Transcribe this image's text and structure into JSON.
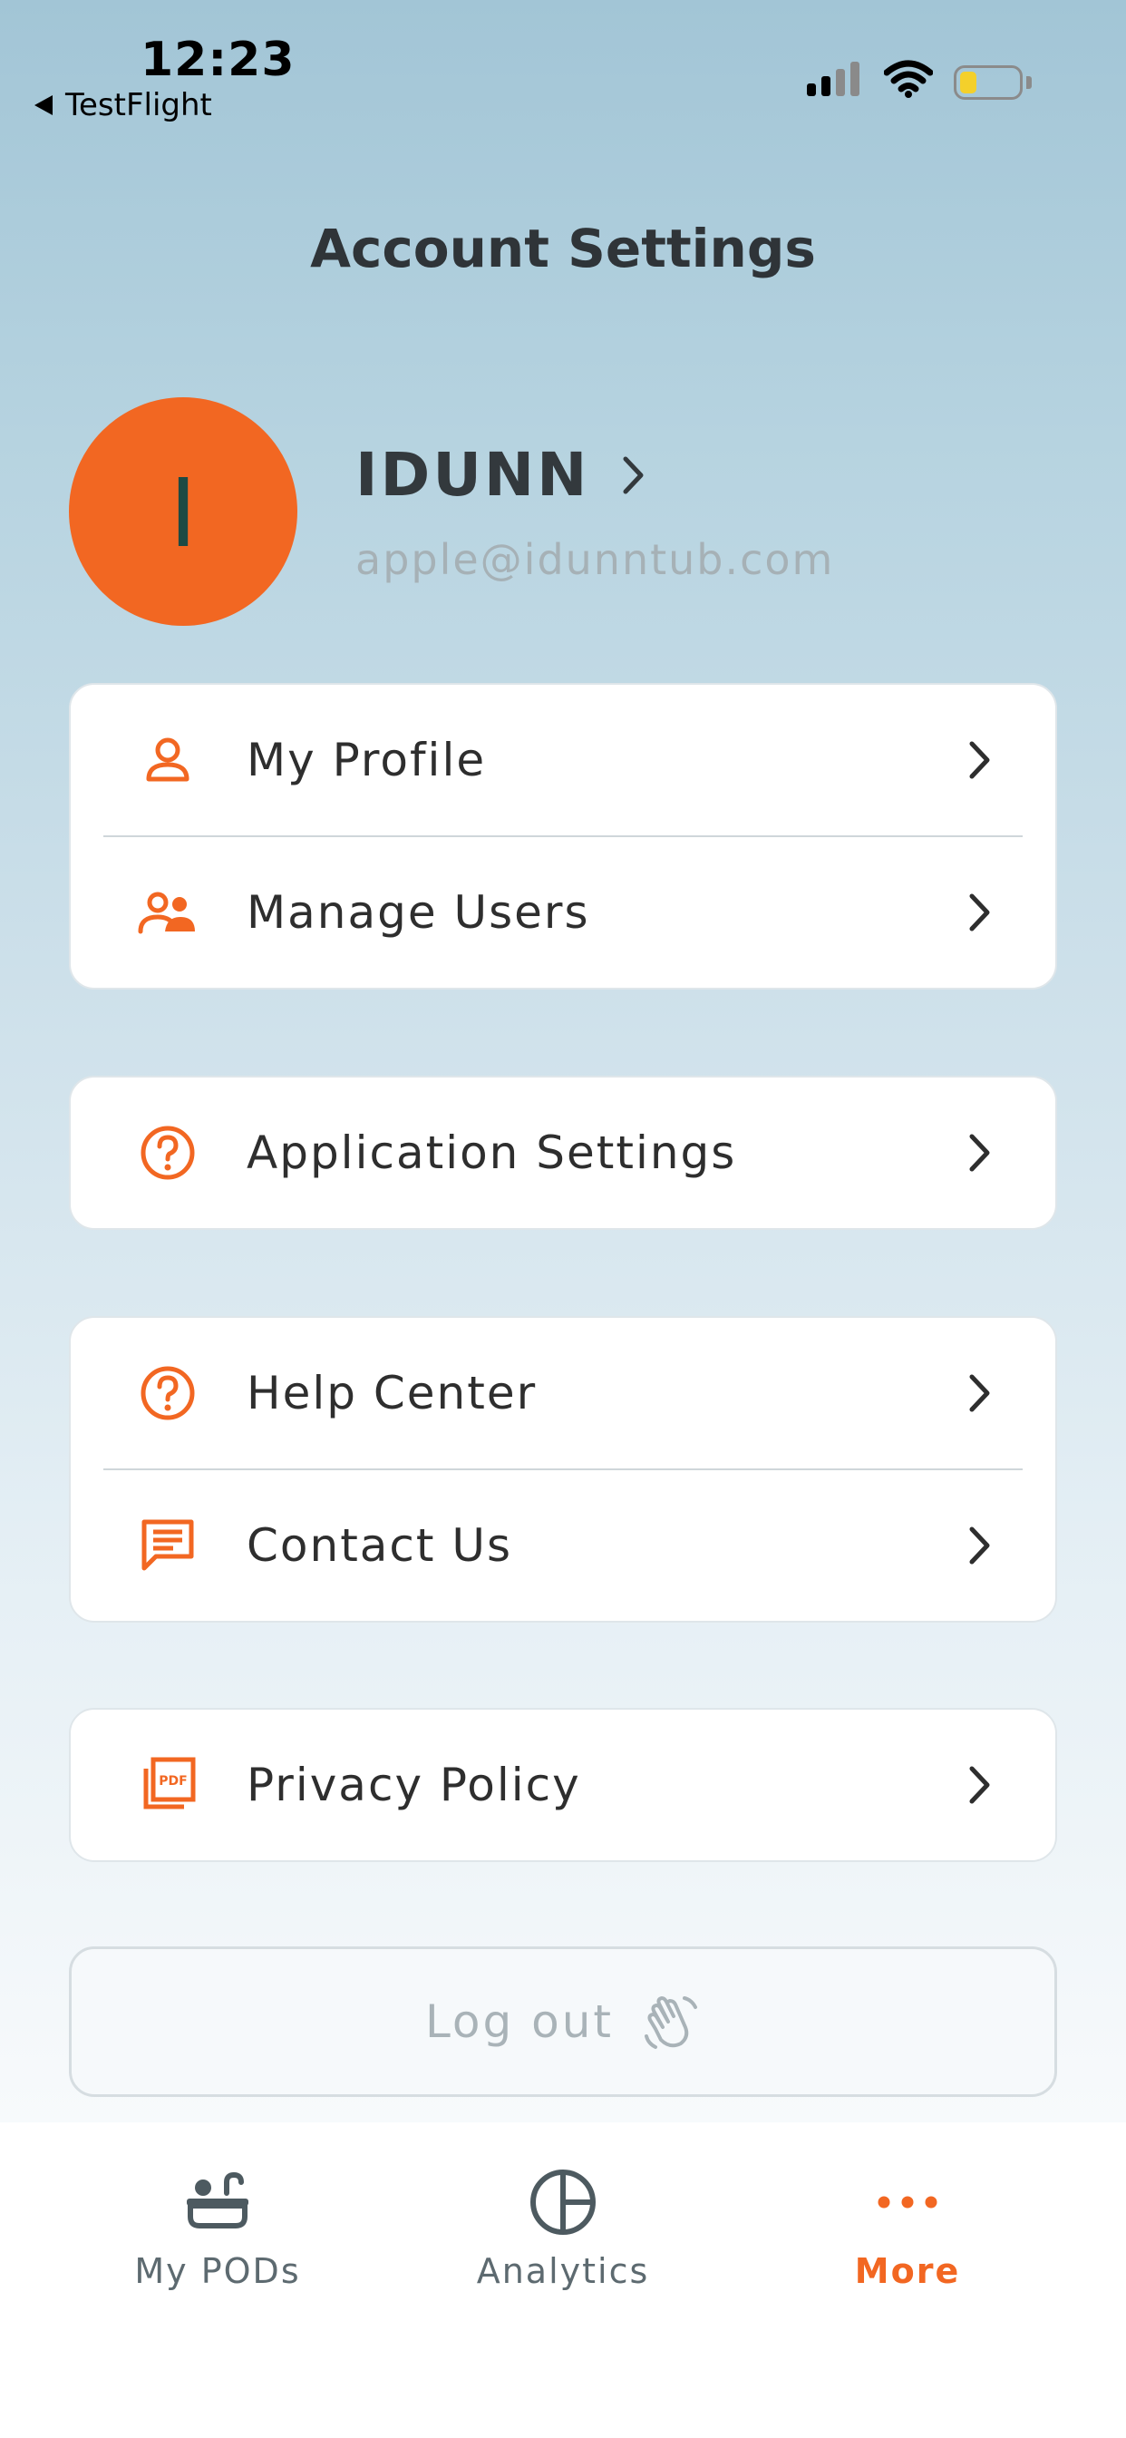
{
  "status_bar": {
    "time": "12:23",
    "back_app": "TestFlight",
    "icons": [
      "signal-icon",
      "wifi-icon",
      "battery-icon"
    ]
  },
  "header": {
    "title": "Account Settings"
  },
  "profile": {
    "initial": "I",
    "name": "IDUNN",
    "email": "apple@idunntub.com",
    "avatar_color": "#f26722"
  },
  "groups": [
    {
      "items": [
        {
          "label": "My Profile",
          "icon": "user-icon"
        },
        {
          "label": "Manage Users",
          "icon": "users-icon"
        }
      ]
    },
    {
      "items": [
        {
          "label": "Application Settings",
          "icon": "question-circle-icon"
        }
      ]
    },
    {
      "items": [
        {
          "label": "Help Center",
          "icon": "question-circle-icon"
        },
        {
          "label": "Contact Us",
          "icon": "chat-icon"
        }
      ]
    },
    {
      "items": [
        {
          "label": "Privacy Policy",
          "icon": "pdf-icon"
        }
      ]
    }
  ],
  "logout": {
    "label": "Log out",
    "icon": "wave-hand-icon"
  },
  "tabs": [
    {
      "label": "My PODs",
      "icon": "bathtub-icon",
      "active": false
    },
    {
      "label": "Analytics",
      "icon": "pie-chart-icon",
      "active": false
    },
    {
      "label": "More",
      "icon": "more-dots-icon",
      "active": true
    }
  ],
  "colors": {
    "accent": "#f26722",
    "text": "#2e2e2e",
    "muted": "#a6b1b6"
  }
}
